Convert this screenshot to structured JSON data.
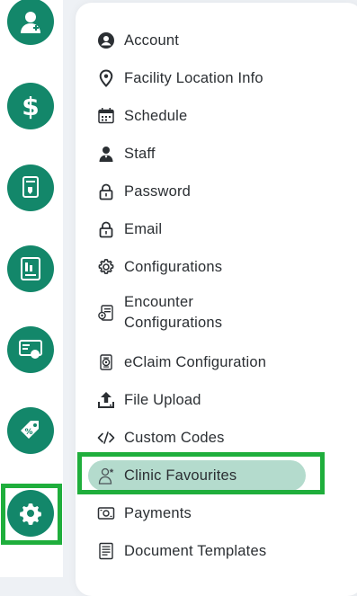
{
  "rail": {
    "items": [
      {
        "icon": "doctor-icon"
      },
      {
        "icon": "dollar-icon"
      },
      {
        "icon": "claim-document-icon"
      },
      {
        "icon": "report-icon"
      },
      {
        "icon": "dashboard-icon"
      },
      {
        "icon": "tag-icon"
      },
      {
        "icon": "gear-icon",
        "selected": true
      }
    ],
    "accent_color": "#13876a",
    "highlight_color": "#1fae3c"
  },
  "menu": {
    "items": [
      {
        "label": "Account",
        "icon": "account-circle-icon"
      },
      {
        "label": "Facility Location Info",
        "icon": "location-pin-icon"
      },
      {
        "label": "Schedule",
        "icon": "calendar-icon"
      },
      {
        "label": "Staff",
        "icon": "staff-icon"
      },
      {
        "label": "Password",
        "icon": "lock-icon"
      },
      {
        "label": "Email",
        "icon": "lock-icon"
      },
      {
        "label": "Configurations",
        "icon": "gear-outline-icon"
      },
      {
        "label": "Encounter Configurations",
        "icon": "encounter-config-icon"
      },
      {
        "label": "eClaim Configuration",
        "icon": "eclaim-icon"
      },
      {
        "label": "File Upload",
        "icon": "upload-icon"
      },
      {
        "label": "Custom Codes",
        "icon": "code-icon"
      },
      {
        "label": "Clinic Favourites",
        "icon": "clinic-favourites-icon",
        "active": true
      },
      {
        "label": "Payments",
        "icon": "payments-icon"
      },
      {
        "label": "Document Templates",
        "icon": "document-templates-icon"
      }
    ],
    "active_color": "#b4dbcd"
  }
}
